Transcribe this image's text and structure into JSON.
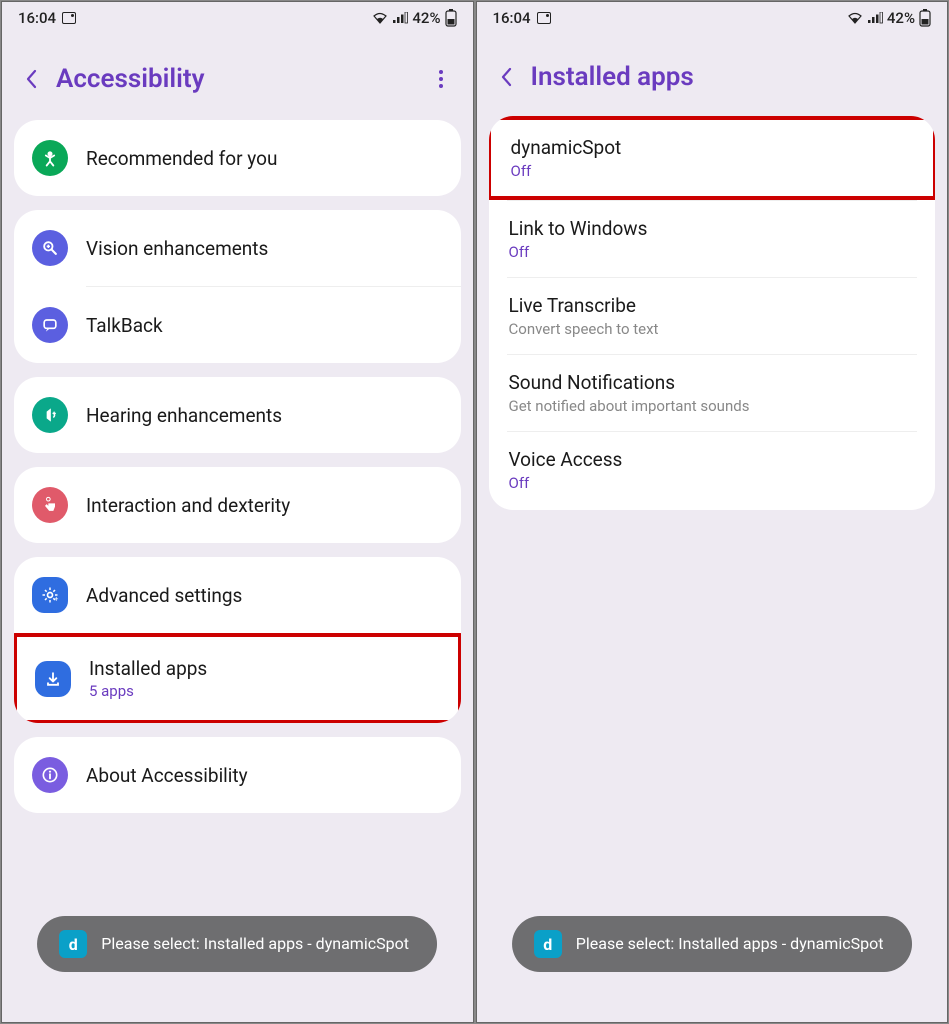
{
  "status": {
    "time": "16:04",
    "battery": "42%"
  },
  "left": {
    "title": "Accessibility",
    "groups": [
      {
        "rows": [
          {
            "icon": "recommended-icon",
            "label": "Recommended for you"
          }
        ]
      },
      {
        "rows": [
          {
            "icon": "vision-icon",
            "label": "Vision enhancements"
          },
          {
            "icon": "talkback-icon",
            "label": "TalkBack"
          }
        ]
      },
      {
        "rows": [
          {
            "icon": "hearing-icon",
            "label": "Hearing enhancements"
          }
        ]
      },
      {
        "rows": [
          {
            "icon": "interaction-icon",
            "label": "Interaction and dexterity"
          }
        ]
      },
      {
        "rows": [
          {
            "icon": "advanced-icon",
            "label": "Advanced settings"
          },
          {
            "icon": "installed-icon",
            "label": "Installed apps",
            "sub": "5 apps",
            "highlight": true
          }
        ]
      },
      {
        "rows": [
          {
            "icon": "about-icon",
            "label": "About Accessibility"
          }
        ]
      }
    ],
    "toast": "Please select: Installed apps - dynamicSpot"
  },
  "right": {
    "title": "Installed apps",
    "apps": [
      {
        "label": "dynamicSpot",
        "sub": "Off",
        "subColor": "purple",
        "highlight": true
      },
      {
        "label": "Link to Windows",
        "sub": "Off",
        "subColor": "purple"
      },
      {
        "label": "Live Transcribe",
        "sub": "Convert speech to text",
        "subColor": "grey"
      },
      {
        "label": "Sound Notifications",
        "sub": "Get notified about important sounds",
        "subColor": "grey"
      },
      {
        "label": "Voice Access",
        "sub": "Off",
        "subColor": "purple"
      }
    ],
    "toast": "Please select: Installed apps - dynamicSpot"
  }
}
